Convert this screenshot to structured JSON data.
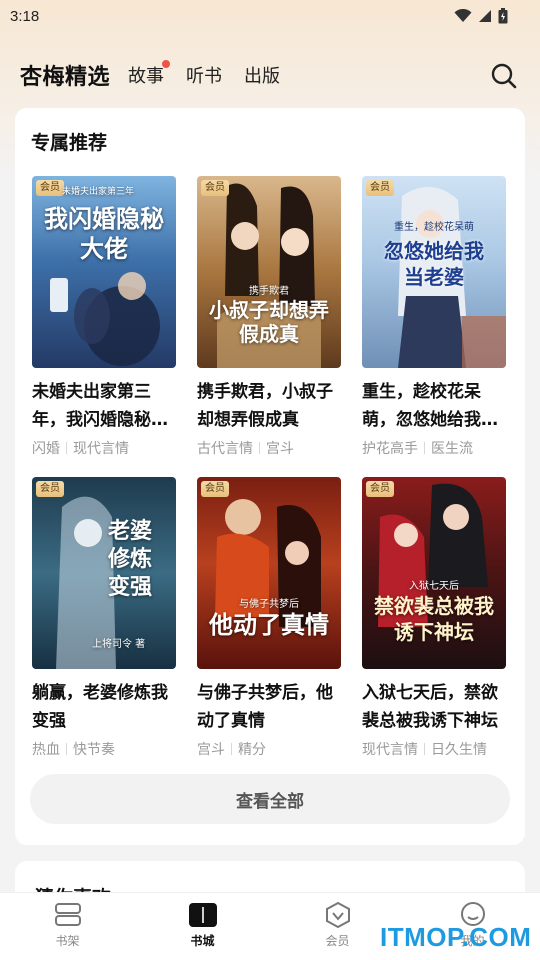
{
  "status_bar": {
    "time": "3:18"
  },
  "top_nav": {
    "brand": "杏梅精选",
    "tabs": [
      {
        "label": "故事",
        "has_dot": true
      },
      {
        "label": "听书"
      },
      {
        "label": "出版"
      }
    ]
  },
  "section": {
    "title": "专属推荐",
    "books": [
      {
        "badge": "会员",
        "cover_text": "我闪婚隐秘大佬",
        "cover_caption": "未婚夫出家第三年",
        "title": "未婚夫出家第三年，我闪婚隐秘大佬",
        "tags": [
          "闪婚",
          "现代言情"
        ]
      },
      {
        "badge": "会员",
        "cover_text": "小叔子却想弄假成真",
        "cover_caption": "携手欺君",
        "title": "携手欺君，小叔子却想弄假成真",
        "tags": [
          "古代言情",
          "宫斗"
        ]
      },
      {
        "badge": "会员",
        "cover_text": "忽悠她给我当老婆",
        "cover_caption": "重生，趁校花呆萌",
        "title": "重生，趁校花呆萌，忽悠她给我当老婆",
        "tags": [
          "护花高手",
          "医生流"
        ]
      },
      {
        "badge": "会员",
        "cover_text": "老婆修炼变强",
        "cover_caption": "上将司令 著",
        "title": "躺赢，老婆修炼我变强",
        "tags": [
          "热血",
          "快节奏"
        ]
      },
      {
        "badge": "会员",
        "cover_text": "他动了真情",
        "cover_caption": "与佛子共梦后",
        "title": "与佛子共梦后，他动了真情",
        "tags": [
          "宫斗",
          "精分"
        ]
      },
      {
        "badge": "会员",
        "cover_text": "禁欲裴总被我诱下神坛",
        "cover_caption": "入狱七天后",
        "title": "入狱七天后，禁欲裴总被我诱下神坛",
        "tags": [
          "现代言情",
          "日久生情"
        ]
      }
    ],
    "view_all": "查看全部"
  },
  "next_section_title": "猜你喜欢",
  "bottom_nav": [
    {
      "label": "书架",
      "icon": "bookshelf-icon",
      "active": false
    },
    {
      "label": "书城",
      "icon": "bookstore-icon",
      "active": true
    },
    {
      "label": "会员",
      "icon": "vip-icon",
      "active": false
    },
    {
      "label": "我的",
      "icon": "profile-icon",
      "active": false
    }
  ],
  "watermark": "ITMOP.COM",
  "colors": {
    "accent_dot": "#f0524a",
    "badge_gold": "#e9c07c",
    "watermark": "#1e9be0"
  }
}
